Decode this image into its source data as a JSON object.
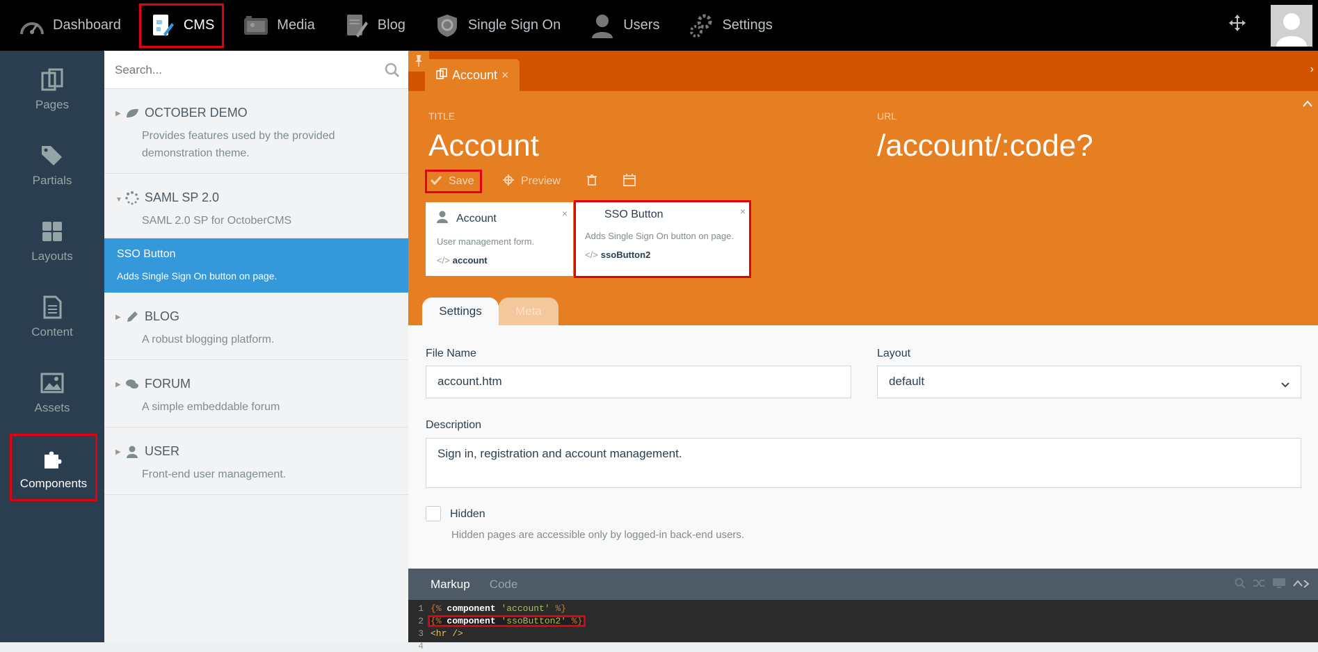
{
  "topnav": {
    "items": [
      {
        "label": "Dashboard",
        "icon": "dashboard-icon"
      },
      {
        "label": "CMS",
        "icon": "cms-icon"
      },
      {
        "label": "Media",
        "icon": "media-icon"
      },
      {
        "label": "Blog",
        "icon": "blog-icon"
      },
      {
        "label": "Single Sign On",
        "icon": "sso-icon"
      },
      {
        "label": "Users",
        "icon": "users-icon"
      },
      {
        "label": "Settings",
        "icon": "settings-icon"
      }
    ]
  },
  "sidenav": {
    "items": [
      {
        "label": "Pages",
        "icon": "pages-icon"
      },
      {
        "label": "Partials",
        "icon": "partials-icon"
      },
      {
        "label": "Layouts",
        "icon": "layouts-icon"
      },
      {
        "label": "Content",
        "icon": "content-icon"
      },
      {
        "label": "Assets",
        "icon": "assets-icon"
      },
      {
        "label": "Components",
        "icon": "components-icon"
      }
    ]
  },
  "search": {
    "placeholder": "Search..."
  },
  "groups": [
    {
      "title": "OCTOBER DEMO",
      "desc": "Provides features used by the provided demonstration theme."
    },
    {
      "title": "SAML SP 2.0",
      "desc": "SAML 2.0 SP for OctoberCMS"
    },
    {
      "title": "BLOG",
      "desc": "A robust blogging platform."
    },
    {
      "title": "FORUM",
      "desc": "A simple embeddable forum"
    },
    {
      "title": "USER",
      "desc": "Front-end user management."
    }
  ],
  "selected_component": {
    "title": "SSO Button",
    "desc": "Adds Single Sign On button on page."
  },
  "tab": {
    "label": "Account",
    "close": "×"
  },
  "page": {
    "title_label": "TITLE",
    "title": "Account",
    "url_label": "URL",
    "url": "/account/:code?"
  },
  "toolbar": {
    "save": "Save",
    "preview": "Preview"
  },
  "cards": [
    {
      "title": "Account",
      "desc": "User management form.",
      "alias": "account",
      "close": "×"
    },
    {
      "title": "SSO Button",
      "desc": "Adds Single Sign On button on page.",
      "alias": "ssoButton2",
      "close": "×"
    }
  ],
  "subtabs": {
    "settings": "Settings",
    "meta": "Meta"
  },
  "form": {
    "filename_label": "File Name",
    "filename": "account.htm",
    "layout_label": "Layout",
    "layout": "default",
    "description_label": "Description",
    "description": "Sign in, registration and account management.",
    "hidden_label": "Hidden",
    "hidden_help": "Hidden pages are accessible only by logged-in back-end users."
  },
  "editor": {
    "tabs": [
      "Markup",
      "Code"
    ],
    "lines": [
      {
        "n": "1",
        "open": "{%",
        "kw": "component",
        "str": "'account'",
        "close": "%}"
      },
      {
        "n": "2",
        "open": "{%",
        "kw": "component",
        "str": "'ssoButton2'",
        "close": "%}"
      },
      {
        "n": "3",
        "html": "<hr />"
      },
      {
        "n": "4",
        "html": ""
      }
    ]
  },
  "colors": {
    "accent": "#e67e22",
    "accent_dark": "#d35400",
    "selected": "#3498db",
    "highlight": "#e3000f"
  }
}
